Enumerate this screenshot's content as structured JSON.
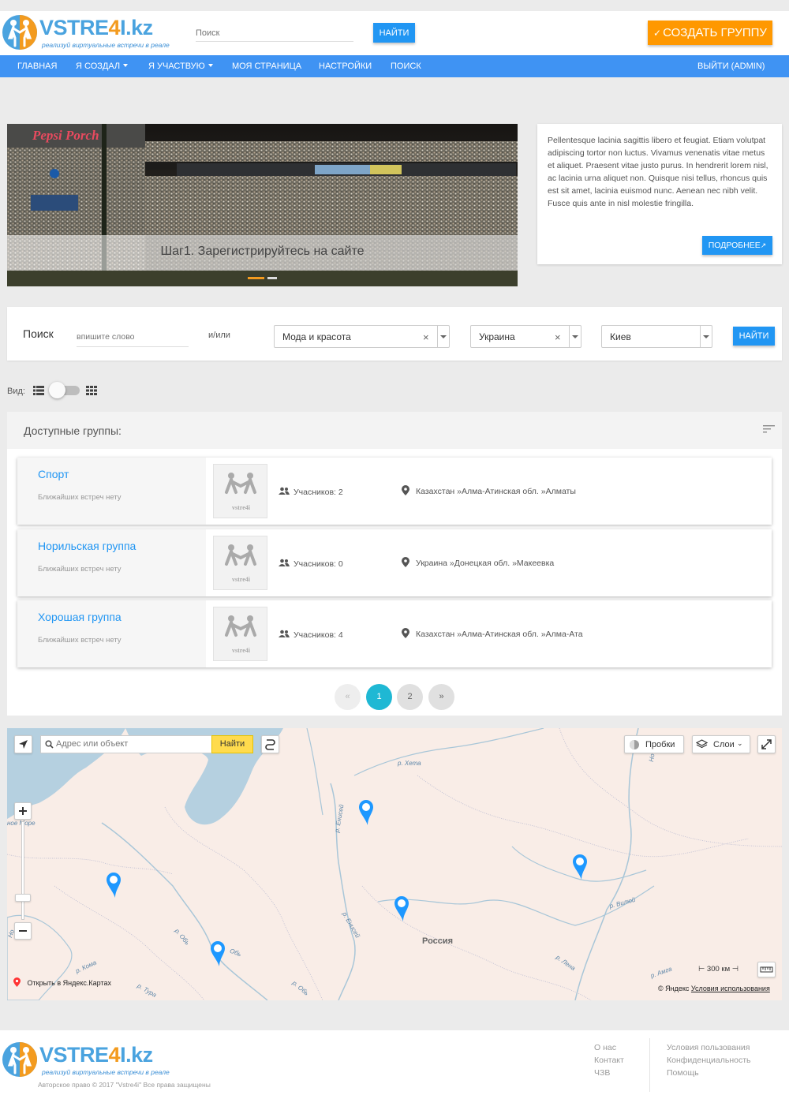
{
  "header": {
    "logo": {
      "part1": "VSTRE",
      "part2": "4",
      "part3": "I",
      "part4": ".kz",
      "tagline": "реализуй виртуальные встречи в реале"
    },
    "search_placeholder": "Поиск",
    "search_button": "НАЙТИ",
    "create_button": "СОЗДАТЬ ГРУППУ"
  },
  "nav": {
    "items": [
      {
        "label": "ГЛАВНАЯ"
      },
      {
        "label": "Я СОЗДАЛ"
      },
      {
        "label": "Я УЧАСТВУЮ"
      },
      {
        "label": "МОЯ СТРАНИЦА"
      },
      {
        "label": "НАСТРОЙКИ"
      },
      {
        "label": "ПОИСК"
      }
    ],
    "logout": "ВЫЙТИ (ADMIN)"
  },
  "slider": {
    "banner_text": "Pepsi Porch",
    "caption": "Шаг1. Зарегистрируйтесь на сайте",
    "slide_count": 2,
    "active_slide": 1
  },
  "info_card": {
    "text": "Pellentesque lacinia sagittis libero et feugiat. Etiam volutpat adipiscing tortor non luctus. Vivamus venenatis vitae metus et aliquet. Praesent vitae justo purus. In hendrerit lorem nisl, ac lacinia urna aliquet non. Quisque nisi tellus, rhoncus quis est sit amet, lacinia euismod nunc. Aenean nec nibh velit. Fusce quis ante in nisl molestie fringilla.",
    "button": "ПОДРОБНЕЕ"
  },
  "search_panel": {
    "label": "Поиск",
    "placeholder": "впишите слово",
    "or_label": "и/или",
    "category": "Мода и красота",
    "country": "Украина",
    "city": "Киев",
    "button": "НАЙТИ"
  },
  "view": {
    "label": "Вид:"
  },
  "groups": {
    "title": "Доступные группы:",
    "items": [
      {
        "name": "Спорт",
        "sub": "Ближайших встреч нету",
        "thumb": "vstre4i",
        "members": "Учасников: 2",
        "location": "Казахстан »Алма-Атинская обл. »Алматы"
      },
      {
        "name": "Норильская группа",
        "sub": "Ближайших встреч нету",
        "thumb": "vstre4i",
        "members": "Учасников: 0",
        "location": "Украина »Донецкая обл. »Макеевка"
      },
      {
        "name": "Хорошая группа",
        "sub": "Ближайших встреч нету",
        "thumb": "vstre4i",
        "members": "Учасников: 4",
        "location": "Казахстан »Алма-Атинская обл. »Алма-Ата"
      }
    ],
    "pagination": {
      "prev": "«",
      "pages": [
        "1",
        "2"
      ],
      "next": "»",
      "current": "1"
    }
  },
  "map": {
    "search_placeholder": "Адрес или объект",
    "search_button": "Найти",
    "traffic": "Пробки",
    "layers": "Слои",
    "country_label": "Россия",
    "sea_label": "ное Море",
    "rivers": [
      "р. Хета",
      "р. Енисей",
      "р. Енисей",
      "р. Обь",
      "Обь",
      "р. Обь",
      "р. Кома",
      "р. Тура",
      "р. Лена",
      "р. Вилюй",
      "р. Амга",
      "Но",
      "Но"
    ],
    "open_link": "Открыть в Яндекс.Картах",
    "scale": "300 км",
    "copyright": "© Яндекс",
    "terms": "Условия использования"
  },
  "footer": {
    "copyright": "Авторское право © 2017 \"Vstre4i\" Все права защищены",
    "links_col1": [
      "О нас",
      "Контакт",
      "ЧЗВ"
    ],
    "links_col2": [
      "Условия пользования",
      "Конфиденциальность",
      "Помощь"
    ]
  },
  "colors": {
    "primary": "#2196f3",
    "nav": "#3f93f3",
    "accent": "#ff9800",
    "pager_active": "#1fb8d4"
  }
}
